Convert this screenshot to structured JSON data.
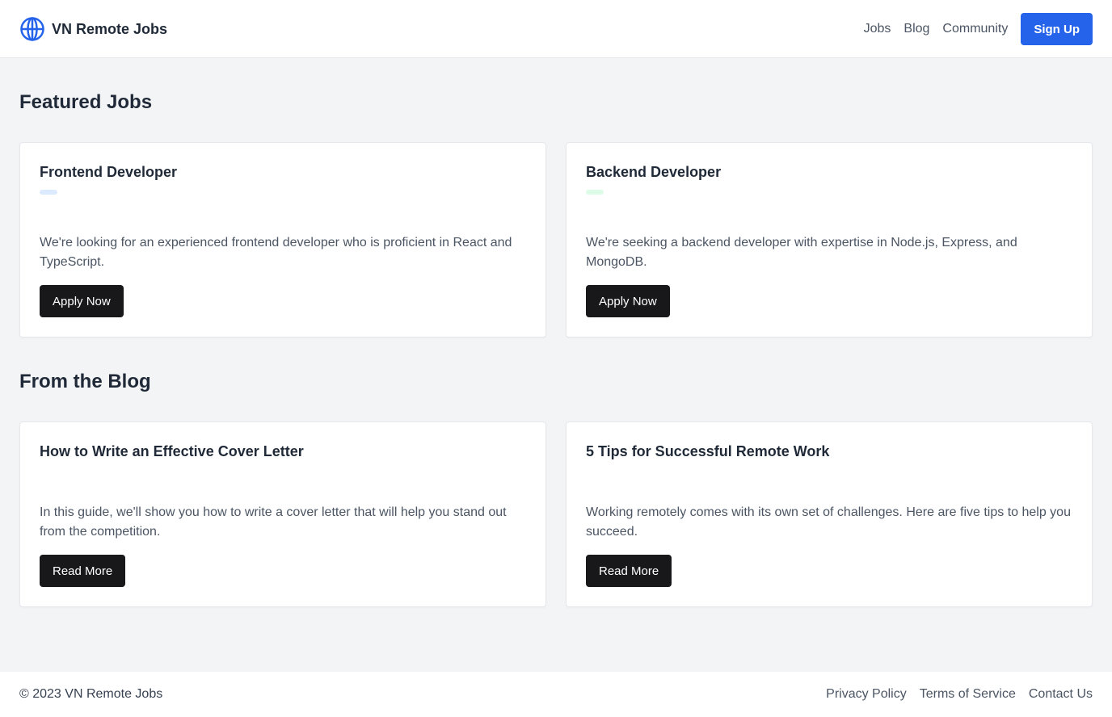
{
  "header": {
    "brand": "VN Remote Jobs",
    "nav": [
      "Jobs",
      "Blog",
      "Community"
    ],
    "signup_label": "Sign Up"
  },
  "jobs_section": {
    "title": "Featured Jobs",
    "cards": [
      {
        "title": "Frontend Developer",
        "tag_color": "#dbeafe",
        "description": "We're looking for an experienced frontend developer who is proficient in React and TypeScript.",
        "button": "Apply Now"
      },
      {
        "title": "Backend Developer",
        "tag_color": "#dcfce7",
        "description": "We're seeking a backend developer with expertise in Node.js, Express, and MongoDB.",
        "button": "Apply Now"
      }
    ]
  },
  "blog_section": {
    "title": "From the Blog",
    "cards": [
      {
        "title": "How to Write an Effective Cover Letter",
        "description": "In this guide, we'll show you how to write a cover letter that will help you stand out from the competition.",
        "button": "Read More"
      },
      {
        "title": "5 Tips for Successful Remote Work",
        "description": "Working remotely comes with its own set of challenges. Here are five tips to help you succeed.",
        "button": "Read More"
      }
    ]
  },
  "footer": {
    "copyright": "© 2023 VN Remote Jobs",
    "links": [
      "Privacy Policy",
      "Terms of Service",
      "Contact Us"
    ]
  },
  "colors": {
    "brand_blue": "#2563eb",
    "button_dark": "#18181b",
    "background": "#f3f4f6"
  },
  "icons": {
    "brand": "globe-icon"
  }
}
